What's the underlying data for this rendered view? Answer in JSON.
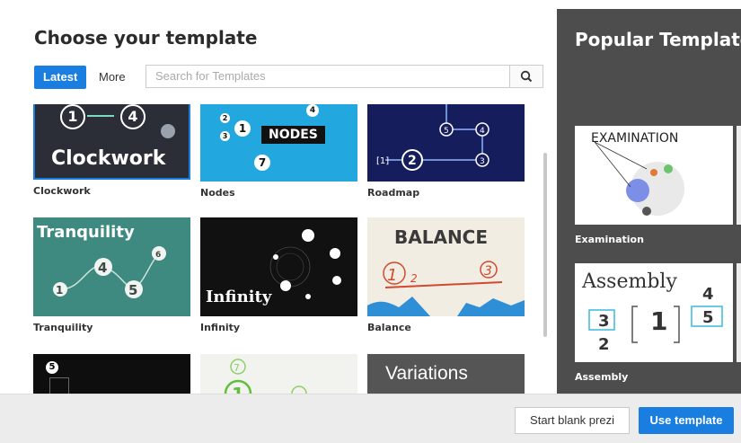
{
  "header": {
    "title": "Choose your template"
  },
  "tabs": [
    {
      "label": "Latest"
    },
    {
      "label": "More"
    }
  ],
  "search": {
    "placeholder": "Search for Templates"
  },
  "templates": [
    {
      "label": "Clockwork",
      "thumb_text": "Clockwork",
      "color": "#2b2e36"
    },
    {
      "label": "Nodes",
      "thumb_text": "NODES",
      "color": "#22a8df"
    },
    {
      "label": "Roadmap",
      "thumb_text": "",
      "color": "#161d5c"
    },
    {
      "label": "Tranquility",
      "thumb_text": "Tranquility",
      "color": "#3f8a80"
    },
    {
      "label": "Infinity",
      "thumb_text": "Infinity",
      "color": "#111111"
    },
    {
      "label": "Balance",
      "thumb_text": "BALANCE",
      "color": "#f1ede2"
    },
    {
      "label": "",
      "thumb_text": "",
      "color": "#0e0e0e"
    },
    {
      "label": "",
      "thumb_text": "",
      "color": "#f2f2ee"
    },
    {
      "label": "",
      "thumb_text": "Variations",
      "color": "#555555"
    }
  ],
  "popular": {
    "title": "Popular Templates",
    "items": [
      {
        "label": "Examination",
        "thumb_text": "EXAMINATION"
      },
      {
        "label": "Assembly",
        "thumb_text": "Assembly"
      }
    ]
  },
  "footer": {
    "start_blank_label": "Start blank prezi",
    "use_template_label": "Use template"
  },
  "colors": {
    "accent": "#1a7ee0",
    "sidebar": "#4d4d4d"
  }
}
